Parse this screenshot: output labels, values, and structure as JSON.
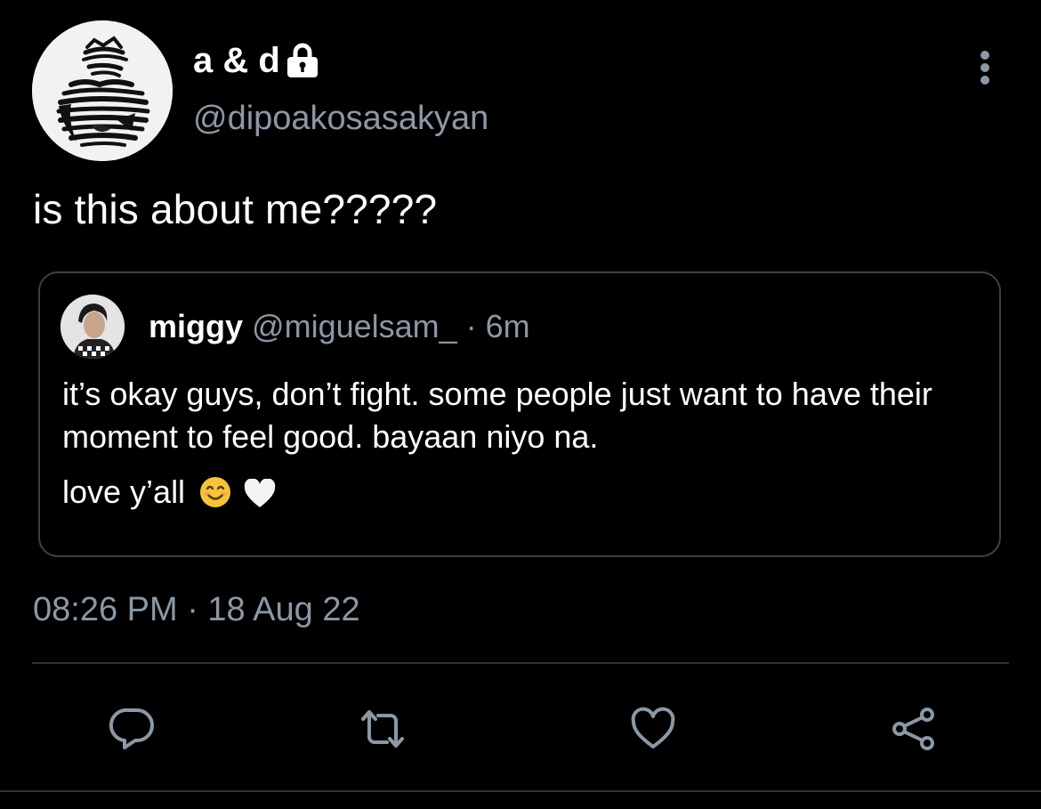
{
  "author": {
    "display_name": "a & d",
    "handle": "@dipoakosasakyan",
    "protected_icon": "lock-icon"
  },
  "tweet": {
    "text": "is this about me?????",
    "timestamp": "08:26 PM · 18 Aug 22"
  },
  "quoted_tweet": {
    "display_name": "miggy",
    "meta": "@miguelsam_ · 6m",
    "line1": "it’s okay guys, don’t fight. some people just want to have their moment to feel good. bayaan niyo na.",
    "line2": "love y’all",
    "emojis": [
      "smiling-face-emoji",
      "white-heart-emoji"
    ]
  },
  "actions": [
    "reply-icon",
    "retweet-icon",
    "like-icon",
    "share-icon"
  ],
  "colors": {
    "background": "#000000",
    "primary_text": "#ffffff",
    "secondary_text": "#8b98a5",
    "border": "#3d4144",
    "action_icon": "#8b98a5"
  }
}
